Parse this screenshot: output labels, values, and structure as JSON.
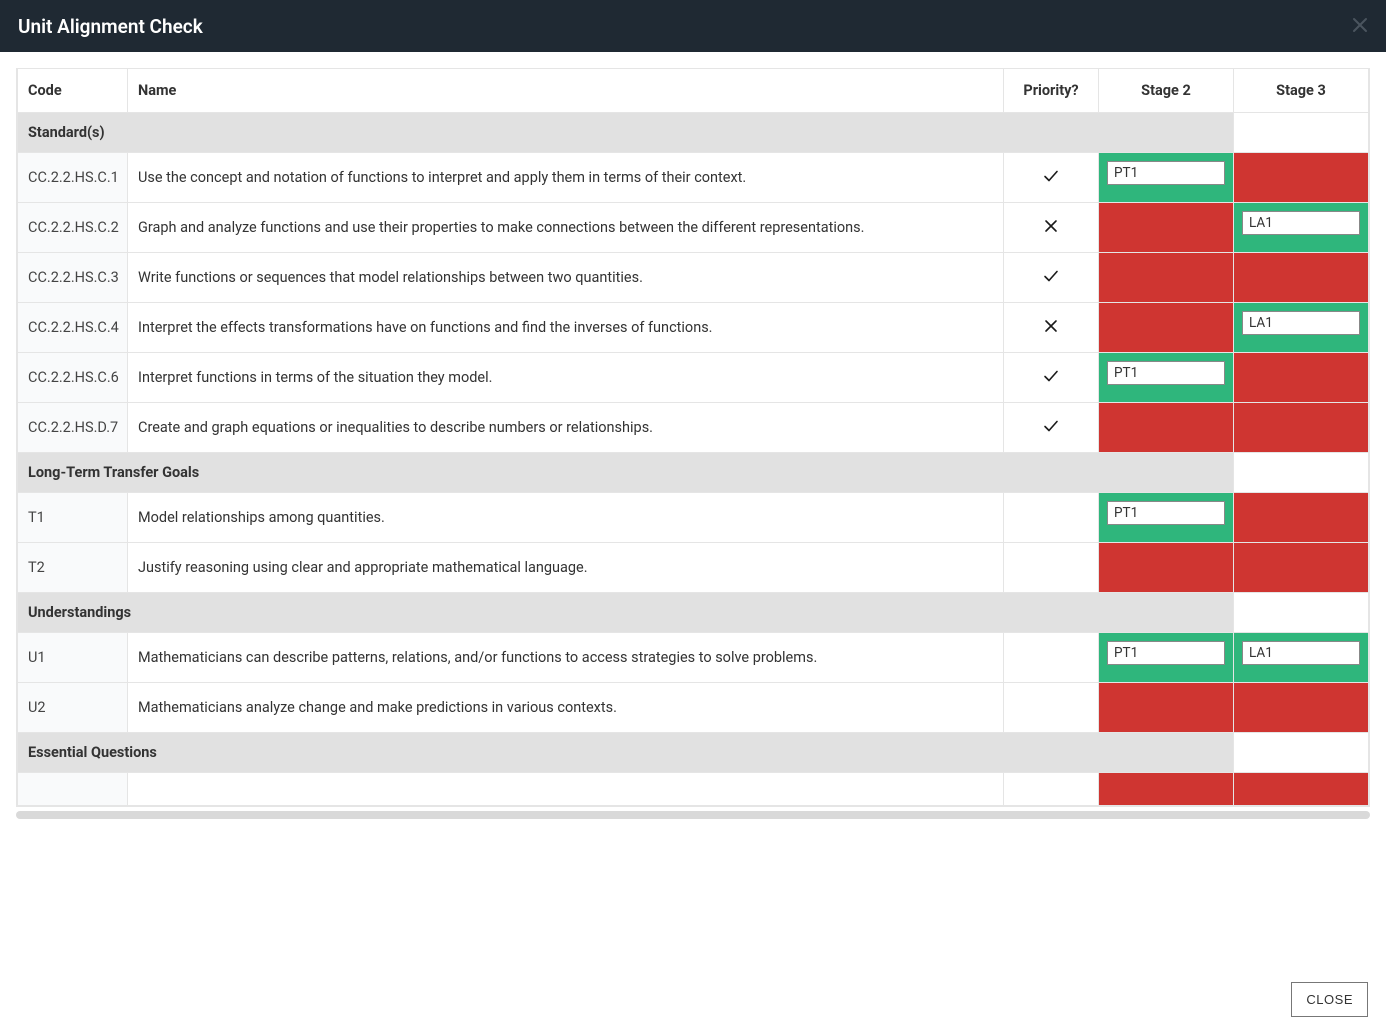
{
  "header": {
    "title": "Unit Alignment Check"
  },
  "columns": {
    "code": "Code",
    "name": "Name",
    "priority": "Priority?",
    "stage2": "Stage 2",
    "stage3": "Stage 3"
  },
  "sections": {
    "standards": "Standard(s)",
    "transfer": "Long-Term Transfer Goals",
    "understandings": "Understandings",
    "eq": "Essential Questions"
  },
  "rows": {
    "standards": [
      {
        "code": "CC.2.2.HS.C.1",
        "name": "Use the concept and notation of functions to interpret and apply them in terms of their context.",
        "priority": "check",
        "stage2": [
          "PT1"
        ],
        "stage3": []
      },
      {
        "code": "CC.2.2.HS.C.2",
        "name": "Graph and analyze functions and use their properties to make connections between the different representations.",
        "priority": "cross",
        "stage2": [],
        "stage3": [
          "LA1"
        ]
      },
      {
        "code": "CC.2.2.HS.C.3",
        "name": "Write functions or sequences that model relationships between two quantities.",
        "priority": "check",
        "stage2": [],
        "stage3": []
      },
      {
        "code": "CC.2.2.HS.C.4",
        "name": "Interpret the effects transformations have on functions and find the inverses of functions.",
        "priority": "cross",
        "stage2": [],
        "stage3": [
          "LA1"
        ]
      },
      {
        "code": "CC.2.2.HS.C.6",
        "name": "Interpret functions in terms of the situation they model.",
        "priority": "check",
        "stage2": [
          "PT1"
        ],
        "stage3": []
      },
      {
        "code": "CC.2.2.HS.D.7",
        "name": "Create and graph equations or inequalities to describe numbers or relationships.",
        "priority": "check",
        "stage2": [],
        "stage3": []
      }
    ],
    "transfer": [
      {
        "code": "T1",
        "name": "Model relationships among quantities.",
        "priority": "",
        "stage2": [
          "PT1"
        ],
        "stage3": []
      },
      {
        "code": "T2",
        "name": "Justify reasoning using clear and appropriate mathematical language.",
        "priority": "",
        "stage2": [],
        "stage3": []
      }
    ],
    "understandings": [
      {
        "code": "U1",
        "name": "Mathematicians can describe patterns, relations, and/or functions to access strategies to solve problems.",
        "priority": "",
        "stage2": [
          "PT1"
        ],
        "stage3": [
          "LA1"
        ]
      },
      {
        "code": "U2",
        "name": "Mathematicians analyze change and make predictions in various contexts.",
        "priority": "",
        "stage2": [],
        "stage3": []
      }
    ],
    "eq": [
      {
        "code": "",
        "name": "",
        "priority": "",
        "stage2": [],
        "stage3": []
      }
    ]
  },
  "footer": {
    "close": "CLOSE"
  },
  "colors": {
    "green": "#2fb67c",
    "red": "#cf3531",
    "headerBg": "#1f2933"
  }
}
